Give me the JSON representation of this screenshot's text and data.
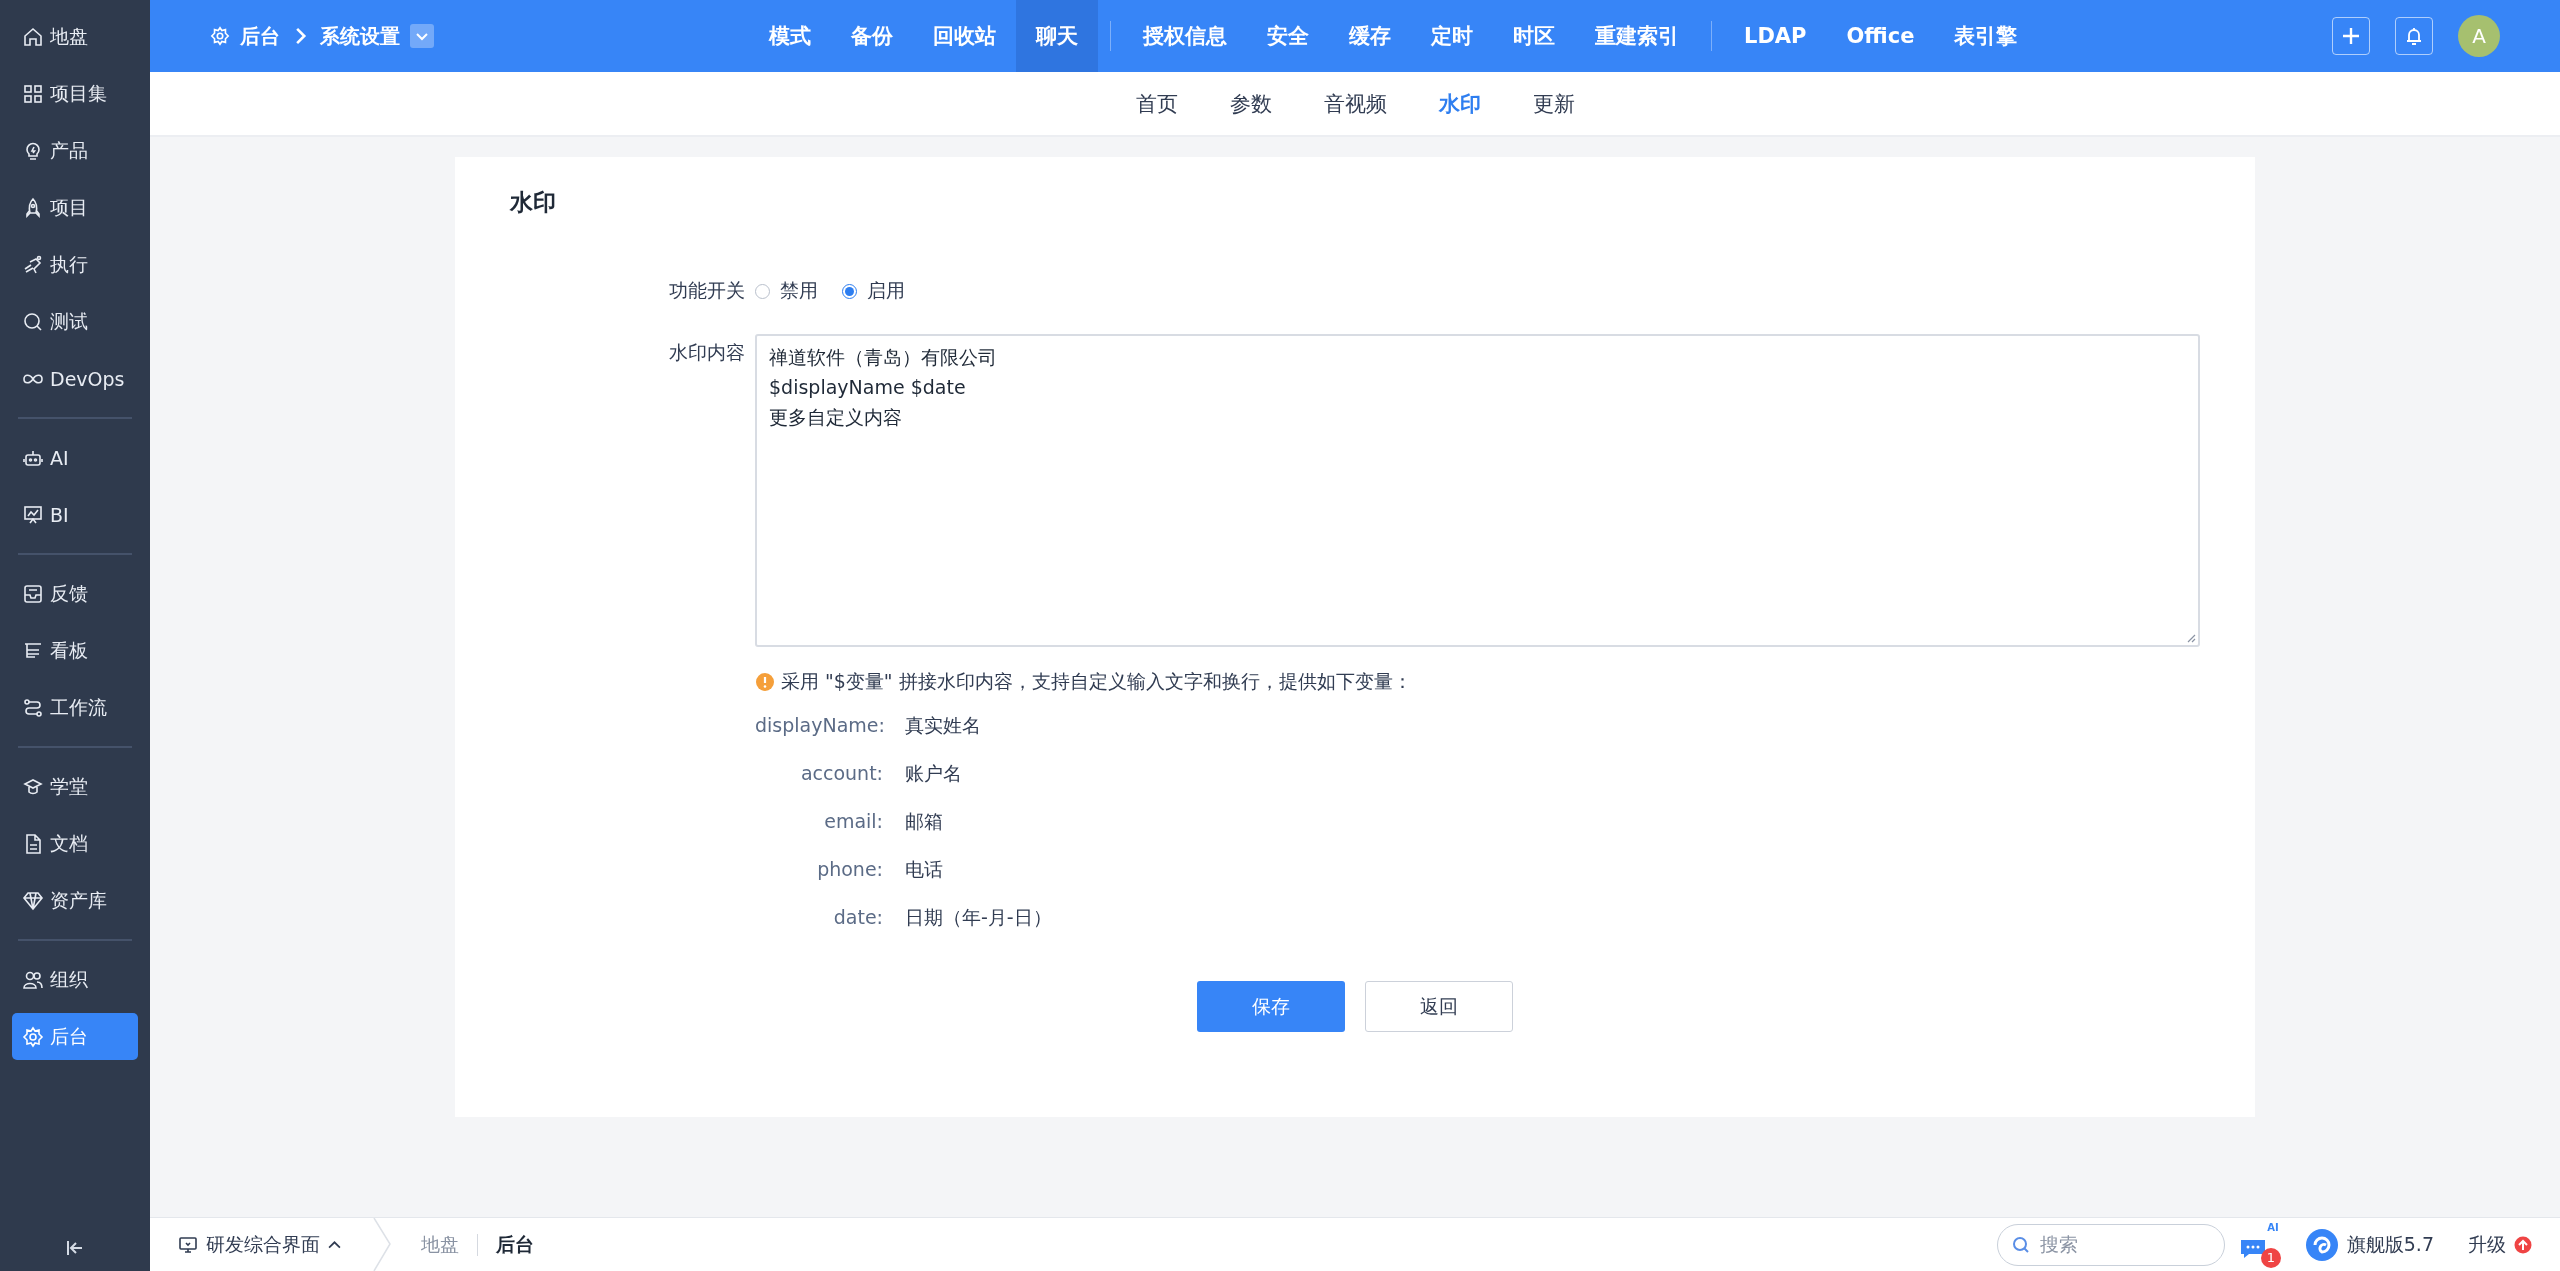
{
  "sidebar": {
    "groups": [
      {
        "items": [
          {
            "label": "地盘",
            "selected": false
          },
          {
            "label": "项目集",
            "selected": false
          },
          {
            "label": "产品",
            "selected": false
          },
          {
            "label": "项目",
            "selected": false
          },
          {
            "label": "执行",
            "selected": false
          },
          {
            "label": "测试",
            "selected": false
          },
          {
            "label": "DevOps",
            "selected": false
          }
        ]
      },
      {
        "items": [
          {
            "label": "AI",
            "selected": false
          },
          {
            "label": "BI",
            "selected": false
          }
        ]
      },
      {
        "items": [
          {
            "label": "反馈",
            "selected": false
          },
          {
            "label": "看板",
            "selected": false
          },
          {
            "label": "工作流",
            "selected": false
          }
        ]
      },
      {
        "items": [
          {
            "label": "学堂",
            "selected": false
          },
          {
            "label": "文档",
            "selected": false
          },
          {
            "label": "资产库",
            "selected": false
          }
        ]
      },
      {
        "items": [
          {
            "label": "组织",
            "selected": false
          },
          {
            "label": "后台",
            "selected": true
          }
        ]
      }
    ]
  },
  "header": {
    "breadcrumb": [
      "后台",
      "系统设置"
    ],
    "nav_groups": [
      {
        "items": [
          {
            "label": "模式",
            "selected": false
          },
          {
            "label": "备份",
            "selected": false
          },
          {
            "label": "回收站",
            "selected": false
          },
          {
            "label": "聊天",
            "selected": true
          }
        ]
      },
      {
        "items": [
          {
            "label": "授权信息",
            "selected": false
          },
          {
            "label": "安全",
            "selected": false
          },
          {
            "label": "缓存",
            "selected": false
          },
          {
            "label": "定时",
            "selected": false
          },
          {
            "label": "时区",
            "selected": false
          },
          {
            "label": "重建索引",
            "selected": false
          }
        ]
      },
      {
        "items": [
          {
            "label": "LDAP",
            "selected": false
          },
          {
            "label": "Office",
            "selected": false
          },
          {
            "label": "表引擎",
            "selected": false
          }
        ]
      }
    ],
    "avatar": "A"
  },
  "subtabs": [
    {
      "label": "首页",
      "selected": false
    },
    {
      "label": "参数",
      "selected": false
    },
    {
      "label": "音视频",
      "selected": false
    },
    {
      "label": "水印",
      "selected": true
    },
    {
      "label": "更新",
      "selected": false
    }
  ],
  "form": {
    "title": "水印",
    "switch": {
      "label": "功能开关",
      "options": [
        {
          "label": "禁用",
          "selected": false
        },
        {
          "label": "启用",
          "selected": true
        }
      ]
    },
    "content": {
      "label": "水印内容",
      "value": "禅道软件（青岛）有限公司\n$displayName $date\n更多自定义内容"
    },
    "hint": "采用 \"$变量\" 拼接水印内容，支持自定义输入文字和换行，提供如下变量：",
    "variables": [
      {
        "key": "displayName:",
        "value": "真实姓名"
      },
      {
        "key": "account:",
        "value": "账户名"
      },
      {
        "key": "email:",
        "value": "邮箱"
      },
      {
        "key": "phone:",
        "value": "电话"
      },
      {
        "key": "date:",
        "value": "日期（年-月-日）"
      }
    ],
    "buttons": [
      {
        "label": "保存",
        "kind": "primary"
      },
      {
        "label": "返回",
        "kind": "secondary"
      }
    ]
  },
  "footer": {
    "app_menu": "研发综合界面",
    "breadcrumb": [
      {
        "label": "地盘",
        "selected": false
      },
      {
        "label": "后台",
        "selected": true
      }
    ],
    "search": {
      "placeholder": "搜索"
    },
    "ai_label": "AI",
    "ai_badge": "1",
    "edition": "旗舰版5.7",
    "upgrade": "升级"
  }
}
